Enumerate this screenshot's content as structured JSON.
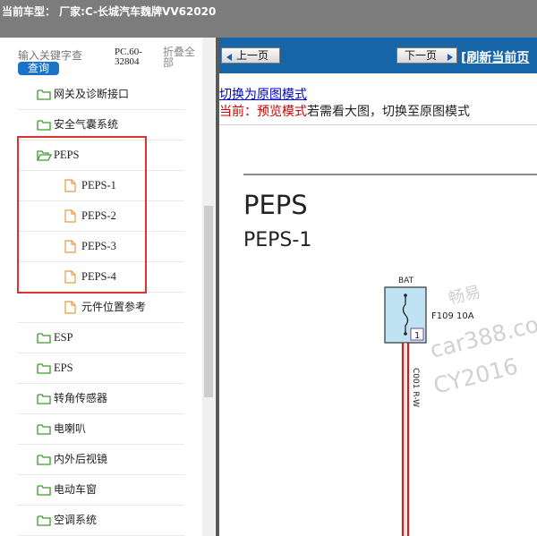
{
  "title_bar": {
    "text": "当前车型： 厂家:C-长城汽车魏牌VV62020"
  },
  "left_pane": {
    "search_placeholder": "输入关键字查",
    "search_button": "查询",
    "model_code": "PC.60-32804",
    "collapse_all": "折叠全部",
    "tree": [
      {
        "label": "网关及诊断接口",
        "level": 1,
        "icon": "folder-icon"
      },
      {
        "label": "安全气囊系统",
        "level": 1,
        "icon": "folder-icon"
      },
      {
        "label": "PEPS",
        "level": 1,
        "icon": "folder-open-icon"
      },
      {
        "label": "PEPS-1",
        "level": 2,
        "icon": "file-icon"
      },
      {
        "label": "PEPS-2",
        "level": 2,
        "icon": "file-icon"
      },
      {
        "label": "PEPS-3",
        "level": 2,
        "icon": "file-icon"
      },
      {
        "label": "PEPS-4",
        "level": 2,
        "icon": "file-icon"
      },
      {
        "label": "元件位置参考",
        "level": 2,
        "icon": "file-icon"
      },
      {
        "label": "ESP",
        "level": 1,
        "icon": "folder-icon"
      },
      {
        "label": "EPS",
        "level": 1,
        "icon": "folder-icon"
      },
      {
        "label": "转角传感器",
        "level": 1,
        "icon": "folder-icon"
      },
      {
        "label": "电喇叭",
        "level": 1,
        "icon": "folder-icon"
      },
      {
        "label": "内外后视镜",
        "level": 1,
        "icon": "folder-icon"
      },
      {
        "label": "电动车窗",
        "level": 1,
        "icon": "folder-icon"
      },
      {
        "label": "空调系统",
        "level": 1,
        "icon": "folder-icon"
      }
    ]
  },
  "right_pane": {
    "prev_button": "上一页",
    "next_button": "下一页",
    "refresh_link": "[刷新当前页",
    "switch_link": "切换为原图模式",
    "current_label": "当前：预览模式",
    "current_hint": "若需看大图，切换至原图模式",
    "diagram": {
      "heading": "PEPS",
      "subheading": "PEPS-1",
      "bat_label": "BAT",
      "fuse_label": "F109 10A",
      "pin_number": "1",
      "wire_label": "C001 R-W",
      "watermark_lines": [
        "畅易",
        "car388.cor",
        "CY2016"
      ]
    }
  },
  "colors": {
    "title_bg": "#7c7c7c",
    "nav_bg": "#1565a8",
    "highlight": "#e03030",
    "folder": "#3c9a2e",
    "file": "#e89b3a",
    "wire": "#c81e1e",
    "fuse_fill": "#bfe3f2"
  }
}
